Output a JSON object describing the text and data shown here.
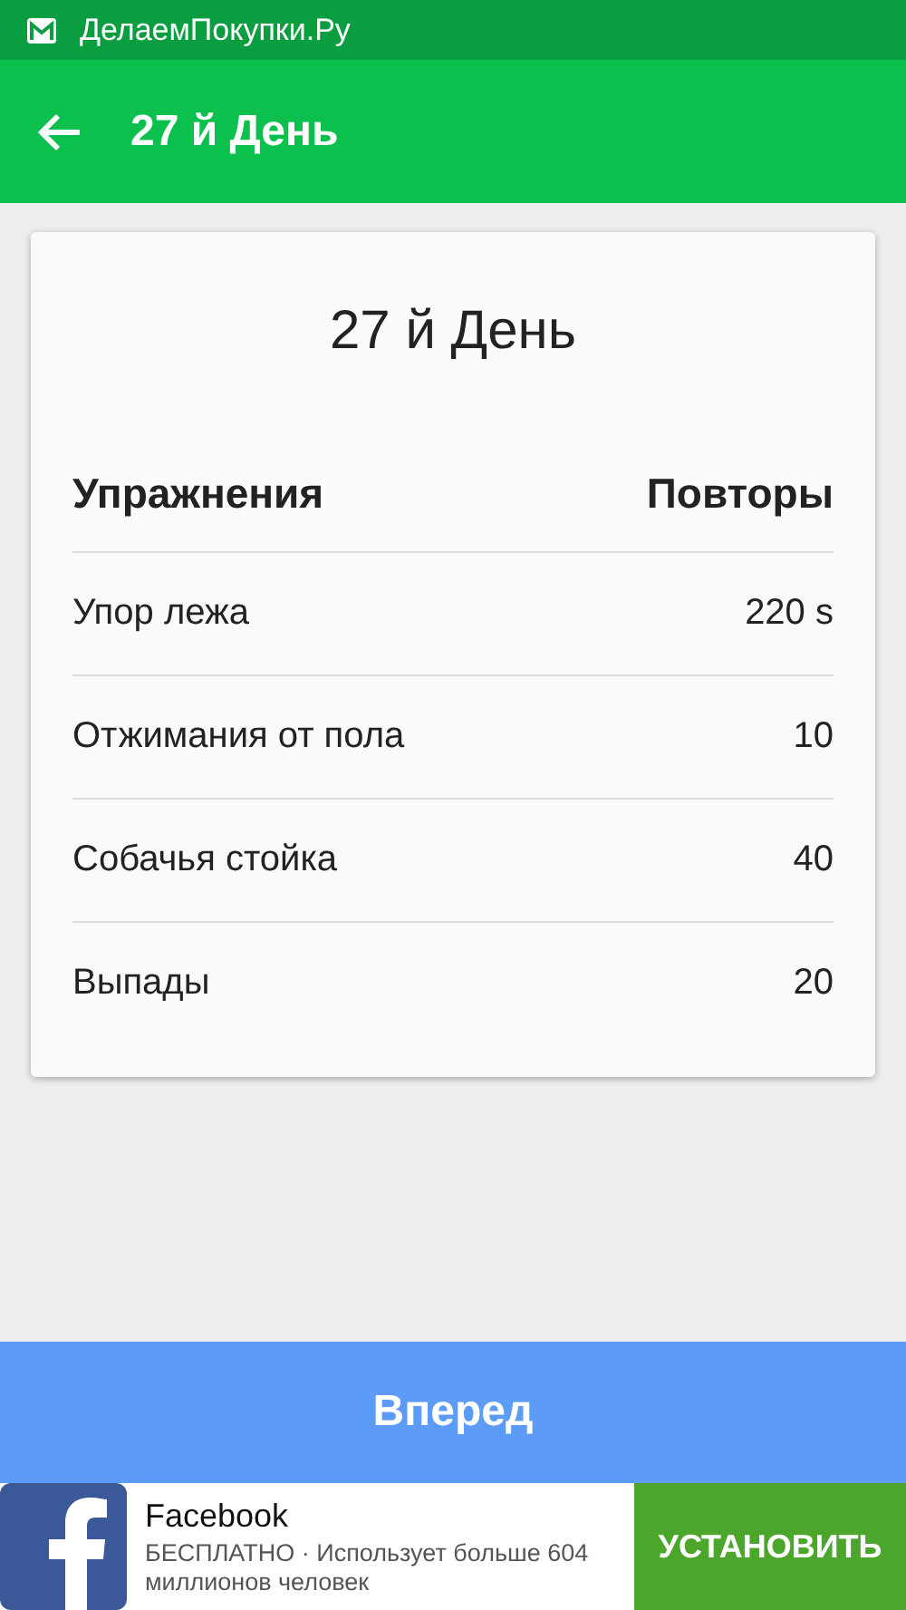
{
  "status_bar": {
    "title": "ДелаемПокупки.Ру"
  },
  "app_bar": {
    "title": "27 й День"
  },
  "card": {
    "title": "27 й День",
    "columns": [
      "Упражнения",
      "Повторы"
    ],
    "rows": [
      {
        "exercise": "Упор лежа",
        "reps": "220 s"
      },
      {
        "exercise": "Отжимания от пола",
        "reps": "10"
      },
      {
        "exercise": "Собачья стойка",
        "reps": "40"
      },
      {
        "exercise": "Выпады",
        "reps": "20"
      }
    ]
  },
  "next_button": "Вперед",
  "ad": {
    "title": "Facebook",
    "description": "БЕСПЛАТНО · Использует больше 604 миллионов человек",
    "install": "УСТАНОВИТЬ"
  }
}
